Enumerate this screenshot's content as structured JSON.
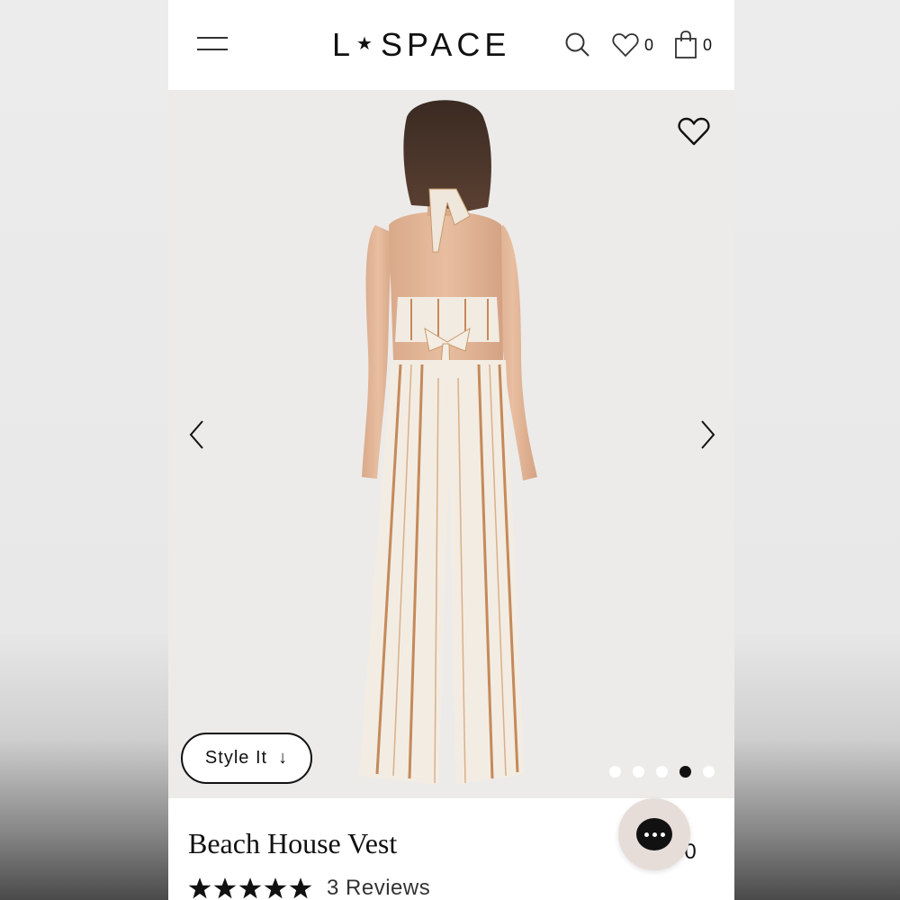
{
  "header": {
    "logo_left": "L",
    "logo_star": "★",
    "logo_right": "SPACE",
    "wishlist_count": "0",
    "cart_count": "0"
  },
  "gallery": {
    "style_it_label": "Style It",
    "style_it_arrow": "↓",
    "dots": 5,
    "active_dot_index": 3,
    "icons": [
      "heart-icon",
      "chevron-left-icon",
      "chevron-right-icon"
    ]
  },
  "product": {
    "title": "Beach House Vest",
    "price_partial": "50",
    "rating": 5,
    "reviews": "3 Reviews"
  },
  "colors": {
    "accent": "#111111",
    "gallery_bg": "#ecebe9",
    "chat_bg": "#e6ddd9"
  }
}
